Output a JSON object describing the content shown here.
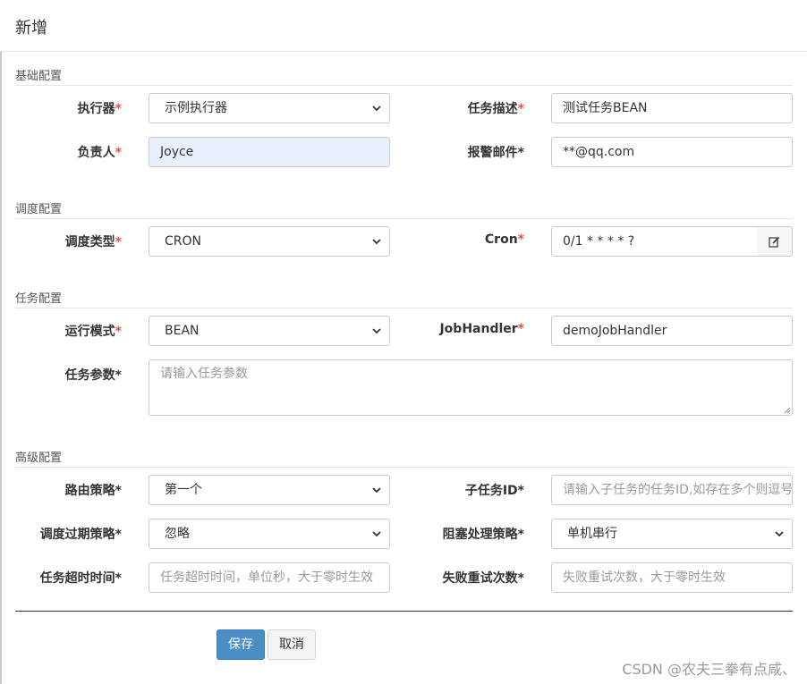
{
  "dialog": {
    "title": "新增"
  },
  "sections": {
    "basic": "基础配置",
    "schedule": "调度配置",
    "task": "任务配置",
    "advanced": "高级配置"
  },
  "fields": {
    "executor": {
      "label": "执行器",
      "value": "示例执行器"
    },
    "task_desc": {
      "label": "任务描述",
      "value": "测试任务BEAN"
    },
    "owner": {
      "label": "负责人",
      "value": "Joyce"
    },
    "alarm_email": {
      "label": "报警邮件",
      "value": "**@qq.com"
    },
    "schedule_type": {
      "label": "调度类型",
      "value": "CRON"
    },
    "cron": {
      "label": "Cron",
      "value": "0/1 * * * * ?"
    },
    "run_mode": {
      "label": "运行模式",
      "value": "BEAN"
    },
    "job_handler": {
      "label": "JobHandler",
      "value": "demoJobHandler"
    },
    "task_param": {
      "label": "任务参数",
      "placeholder": "请输入任务参数"
    },
    "route_strategy": {
      "label": "路由策略",
      "value": "第一个"
    },
    "child_job_id": {
      "label": "子任务ID",
      "placeholder": "请输入子任务的任务ID,如存在多个则逗号分隔"
    },
    "misfire_strategy": {
      "label": "调度过期策略",
      "value": "忽略"
    },
    "block_strategy": {
      "label": "阻塞处理策略",
      "value": "单机串行"
    },
    "timeout": {
      "label": "任务超时时间",
      "placeholder": "任务超时时间，单位秒，大于零时生效"
    },
    "retry_count": {
      "label": "失败重试次数",
      "placeholder": "失败重试次数，大于零时生效"
    }
  },
  "buttons": {
    "save": "保存",
    "cancel": "取消"
  },
  "watermark": "CSDN @农夫三拳有点咸、",
  "icons": {
    "cron_edit": "edit-icon",
    "select_arrow": "chevron-down-icon"
  },
  "colors": {
    "required": "#d9534f",
    "primary": "#4b8dc5",
    "autofill": "#e8f0fe"
  }
}
